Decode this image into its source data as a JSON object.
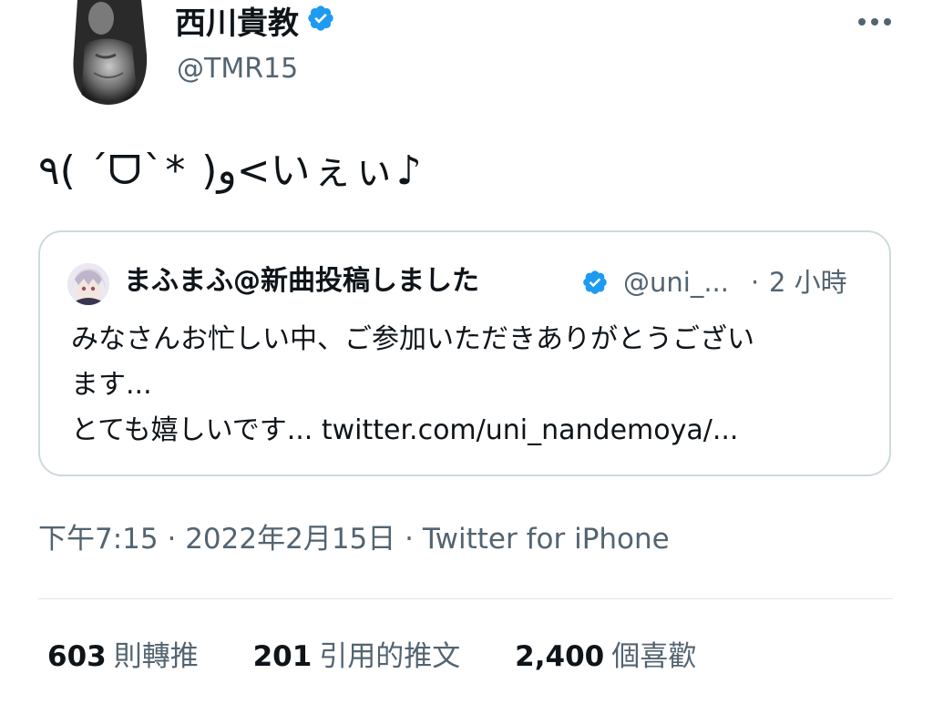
{
  "author": {
    "name": "西川貴教",
    "handle": "@TMR15",
    "verified": true
  },
  "tweet": {
    "text": "٩( ˊᗜˋ* )و<いぇぃ♪"
  },
  "quote": {
    "name": "まふまふ@新曲投稿しました",
    "handle": "@uni_...",
    "separator": "·",
    "time": "2 小時",
    "lines": [
      "みなさんお忙しい中、ご参加いただきありがとうござい",
      "ます...",
      "とても嬉しいです... twitter.com/uni_nandemoya/..."
    ]
  },
  "meta": {
    "time": "下午7:15",
    "date": "2022年2月15日",
    "source": "Twitter for iPhone",
    "separator": "·"
  },
  "stats": [
    {
      "count": "603",
      "label": "則轉推"
    },
    {
      "count": "201",
      "label": "引用的推文"
    },
    {
      "count": "2,400",
      "label": "個喜歡"
    }
  ],
  "colors": {
    "verified": "#1d9bf0",
    "secondary_text": "#536471",
    "border": "#cfd9de"
  },
  "icons": {
    "more": "more-horizontal-icon",
    "verified": "verified-badge-icon"
  }
}
